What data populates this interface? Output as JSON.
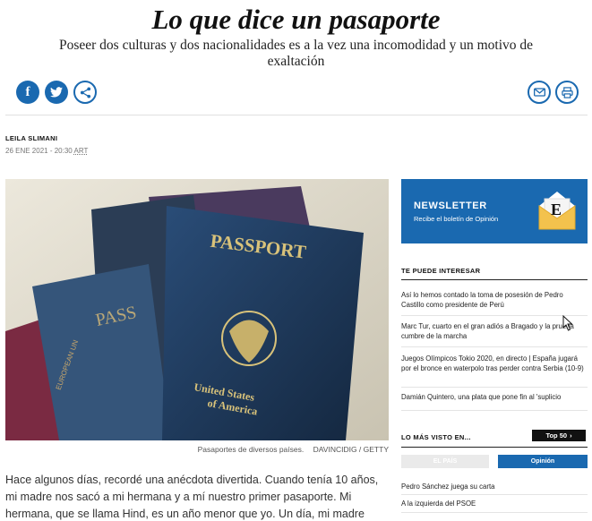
{
  "article": {
    "title": "Lo que dice un pasaporte",
    "subtitle": "Poseer dos culturas y dos nacionalidades es a la vez una incomodidad y un motivo de exaltación",
    "author": "LEILA SLIMANI",
    "date": "26 ENE 2021 - 20:30",
    "timezone": "ART",
    "photo_text_main": "PASSPORT",
    "photo_text_country1": "United States",
    "photo_text_country2": "of America",
    "photo_text_side": "PASS",
    "photo_text_eu": "EUROPEAN UN",
    "caption": "Pasaportes de diversos países.",
    "credit": "DAVINCIDIG / GETTY",
    "body": "Hace algunos días, recordé una anécdota divertida. Cuando tenía 10 años, mi madre nos sacó a mi hermana y a mí nuestro primer pasaporte. Mi hermana, que se llama Hind, es un año menor que yo. Un día, mi madre volvió a casa con"
  },
  "share": {
    "facebook": "f",
    "icons": [
      "facebook-icon",
      "twitter-icon",
      "share-icon",
      "mail-icon",
      "print-icon"
    ]
  },
  "newsletter": {
    "title": "NEWSLETTER",
    "subtitle": "Recibe el boletín de Opinión",
    "logo_letter": "E"
  },
  "interest": {
    "heading": "TE PUEDE INTERESAR",
    "items": [
      "Así lo hemos contado la toma de posesión de Pedro Castillo como presidente de Perú",
      "Marc Tur, cuarto en el gran adiós a Bragado y la prueba cumbre de la marcha",
      "Juegos Olímpicos Tokio 2020, en directo | España jugará por el bronce en waterpolo tras perder contra Serbia (10-9)",
      "Damián Quintero, una plata que pone fin al 'suplicio"
    ]
  },
  "most_viewed": {
    "heading": "LO MÁS VISTO EN...",
    "badge": "Top 50",
    "badge_arrow": "›",
    "tabs": [
      "EL PAÍS",
      "Opinión"
    ],
    "items": [
      "Pedro Sánchez juega su carta",
      "A la izquierda del PSOE"
    ]
  },
  "colors": {
    "accent": "#1a69b0",
    "passport_blue": "#1f3a5e",
    "gold": "#d8c27a"
  }
}
